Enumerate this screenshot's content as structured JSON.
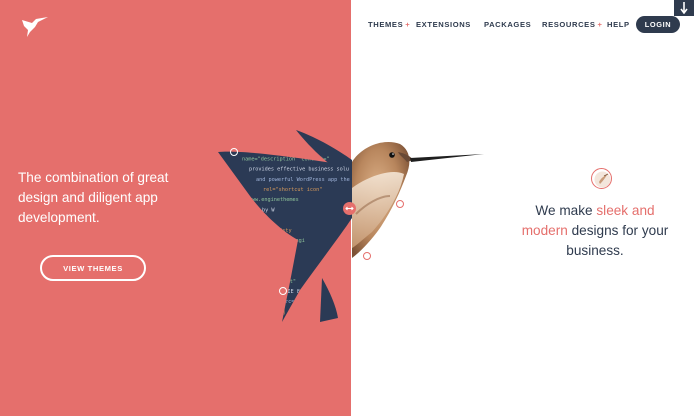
{
  "nav": {
    "items": [
      {
        "label": "THEMES",
        "has_plus": true
      },
      {
        "label": "EXTENSIONS",
        "has_plus": false
      },
      {
        "label": "PACKAGES",
        "has_plus": false
      },
      {
        "label": "RESOURCES",
        "has_plus": true
      },
      {
        "label": "HELP",
        "has_plus": false
      }
    ],
    "plus": "+",
    "login": "LOGIN"
  },
  "hero": {
    "left_text": "The combination of great design and diligent app development.",
    "button": "VIEW THEMES",
    "right_pre": "We make ",
    "right_accent1": "sleek and",
    "right_accent2": "modern",
    "right_post": " designs for your business."
  },
  "code_lines": [
    "ocible\"",
    "enginethemes\">",
    "name=\"description\" content=\"",
    "provides effective business solu",
    "and powerful WordPress app the",
    "rel=\"shortcut icon\"",
    "href=\"www.enginethemes",
    "Powered by W",
    "<!-- s",
    "link rel=\"sty",
    "href=\"core_engi",
    "powerful",
    "/simplicity.css",
    "media=\"screen\" /",
    "rel=\"stylesheet\"",
    "<!--[if lt IE 8]",
    "script src=\"",
    "endif] -->"
  ],
  "colors": {
    "coral": "#e56f6c",
    "navy": "#2f3b4e",
    "wing": "#2b3a55",
    "white": "#ffffff"
  },
  "icons": {
    "logo": "hummingbird-logo-icon",
    "scroll": "arrow-down-icon",
    "slider": "left-right-arrow-icon"
  }
}
